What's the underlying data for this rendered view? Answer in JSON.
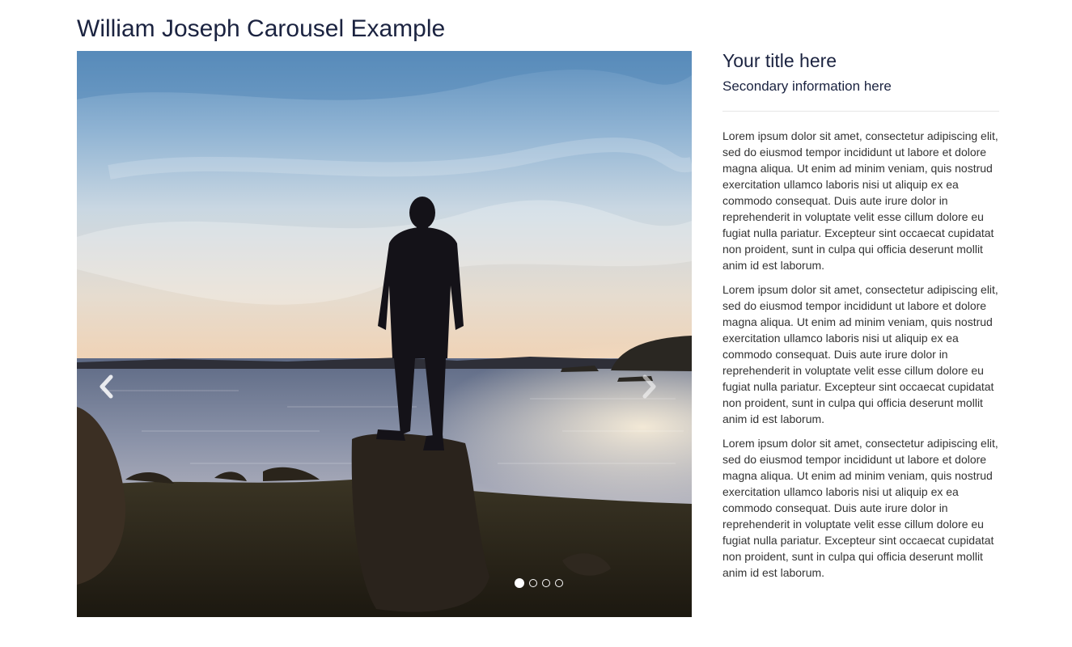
{
  "page": {
    "title": "William Joseph Carousel Example"
  },
  "carousel": {
    "slide_description_icon": "person-on-rock-sunset-image",
    "prev_icon": "chevron-left-icon",
    "next_icon": "chevron-right-icon",
    "slide_count": 4,
    "active_slide": 1
  },
  "sidebar": {
    "title": "Your title here",
    "subtitle": "Secondary information here",
    "paragraphs": [
      "Lorem ipsum dolor sit amet, consectetur adipiscing elit, sed do eiusmod tempor incididunt ut labore et dolore magna aliqua. Ut enim ad minim veniam, quis nostrud exercitation ullamco laboris nisi ut aliquip ex ea commodo consequat. Duis aute irure dolor in reprehenderit in voluptate velit esse cillum dolore eu fugiat nulla pariatur. Excepteur sint occaecat cupidatat non proident, sunt in culpa qui officia deserunt mollit anim id est laborum.",
      "Lorem ipsum dolor sit amet, consectetur adipiscing elit, sed do eiusmod tempor incididunt ut labore et dolore magna aliqua. Ut enim ad minim veniam, quis nostrud exercitation ullamco laboris nisi ut aliquip ex ea commodo consequat. Duis aute irure dolor in reprehenderit in voluptate velit esse cillum dolore eu fugiat nulla pariatur. Excepteur sint occaecat cupidatat non proident, sunt in culpa qui officia deserunt mollit anim id est laborum.",
      "Lorem ipsum dolor sit amet, consectetur adipiscing elit, sed do eiusmod tempor incididunt ut labore et dolore magna aliqua. Ut enim ad minim veniam, quis nostrud exercitation ullamco laboris nisi ut aliquip ex ea commodo consequat. Duis aute irure dolor in reprehenderit in voluptate velit esse cillum dolore eu fugiat nulla pariatur. Excepteur sint occaecat cupidatat non proident, sunt in culpa qui officia deserunt mollit anim id est laborum."
    ]
  },
  "colors": {
    "heading": "#1b2340",
    "body_text": "#333333",
    "divider": "#e6e6e6"
  }
}
